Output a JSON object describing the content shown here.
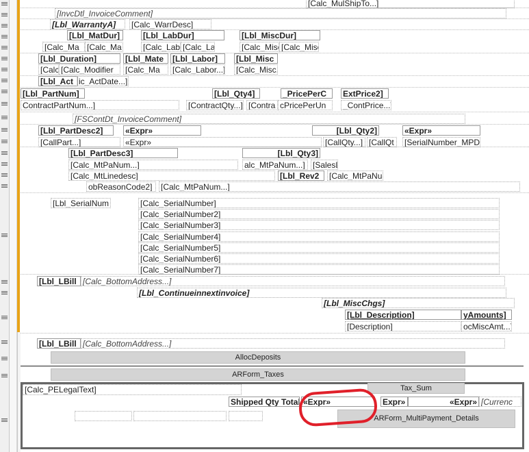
{
  "top": {
    "calc_mulshipto": "[Calc_MulShipTo...]",
    "invcdtl_comment": "[InvcDtl_InvoiceComment]",
    "lbl_warranty": "[Lbl_WarrantyA]",
    "calc_warrdesc": "[Calc_WarrDesc]",
    "lbl_matdur": "[Lbl_MatDur]",
    "lbl_labdur": "[Lbl_LabDur]",
    "lbl_miscdur": "[Lbl_MiscDur]",
    "calc_ma1": "[Calc_Ma",
    "calc_ma2": "[Calc_Ma",
    "calc_lab1": "[Calc_Lab",
    "calc_la": "[Calc_La",
    "calc_misc1": "[Calc_Misc",
    "calc_misc2": "[Calc_Misc",
    "lbl_duration": "[Lbl_Duration]",
    "lbl_mate": "[Lbl_Mate",
    "lbl_labor": "[Lbl_Labor]",
    "lbl_misc": "[Lbl_Misc",
    "calc_c": "[Calc",
    "calc_modifier": "[Calc_Modifier",
    "calc_ma3": "[Calc_Ma",
    "calc_labor": "[Calc_Labor...]",
    "calc_misc3": "[Calc_Misc.",
    "lbl_act": "[Lbl_Act",
    "ic_actdate": "ic_ActDate...]"
  },
  "contract": {
    "lbl_partnum": "[Lbl_PartNum]",
    "lbl_qty4": "[Lbl_Qty4]",
    "priceperc": "_PricePerC",
    "extprice2": "ExtPrice2]",
    "contractpartnum": "ContractPartNum...]",
    "contractqty": "[ContractQty...]",
    "contra": "[Contra",
    "pricperun": "cPricePerUn",
    "contprice": "_ContPrice...]",
    "fscont_comment": "[FSContDt_InvoiceComment]"
  },
  "desc": {
    "lbl_partdesc2": "[Lbl_PartDesc2]",
    "expr1": "«Expr»",
    "lbl_qty2": "[Lbl_Qty2]",
    "expr2": "«Expr»",
    "callpart": "[CallPart...]",
    "expr3": "«Expr»",
    "callqty": "[CallQty...]",
    "callqt": "[CallQt",
    "serialnumber_mpd": "[SerialNumber_MPD",
    "lbl_partdesc3": "[Lbl_PartDesc3]",
    "lbl_qty3": "[Lbl_Qty3]",
    "calc_mtpanum1": "[Calc_MtPaNum...]",
    "alc_mtpanum": "alc_MtPaNum...]",
    "salest": "[SalesL",
    "calc_mtlinedesc": "[Calc_MtLinedesc]",
    "lbl_rev2": "[Lbl_Rev2",
    "calc_mtpanu": "[Calc_MtPaNu",
    "obreasoncode2": "obReasonCode2]",
    "calc_mtpanum2": "[Calc_MtPaNum...]"
  },
  "serial": {
    "lbl_serialnum": "[Lbl_SerialNum",
    "rows": [
      "[Calc_SerialNumber]",
      "[Calc_SerialNumber2]",
      "[Calc_SerialNumber3]",
      "[Calc_SerialNumber4]",
      "[Calc_SerialNumber5]",
      "[Calc_SerialNumber6]",
      "[Calc_SerialNumber7]"
    ]
  },
  "bottom": {
    "lbl_lbill1": "[Lbl_LBill",
    "calc_bottomaddress1": "[Calc_BottomAddress...]",
    "lbl_continue": "[Lbl_Continueinnextinvoice]",
    "lbl_miscchgs": "[Lbl_MiscChgs]",
    "lbl_description": "[Lbl_Description]",
    "yamounts": "yAmounts]",
    "description": "[Description]",
    "ocmiscamt": "ocMiscAmt...]",
    "lbl_lbill2": "[Lbl_LBill",
    "calc_bottomaddress2": "[Calc_BottomAddress...]",
    "allocdeposits": "AllocDeposits",
    "arform_taxes": "ARForm_Taxes",
    "calc_pelegal": "[Calc_PELegalText]",
    "tax_sum": "Tax_Sum",
    "shipped_qty": "Shipped Qty Total:",
    "expr_circled": "«Expr»",
    "expr_a": "Expr»",
    "expr_b": "«Expr»",
    "currenc": "[Currenc",
    "multipayment": "ARForm_MultiPayment_Details"
  }
}
